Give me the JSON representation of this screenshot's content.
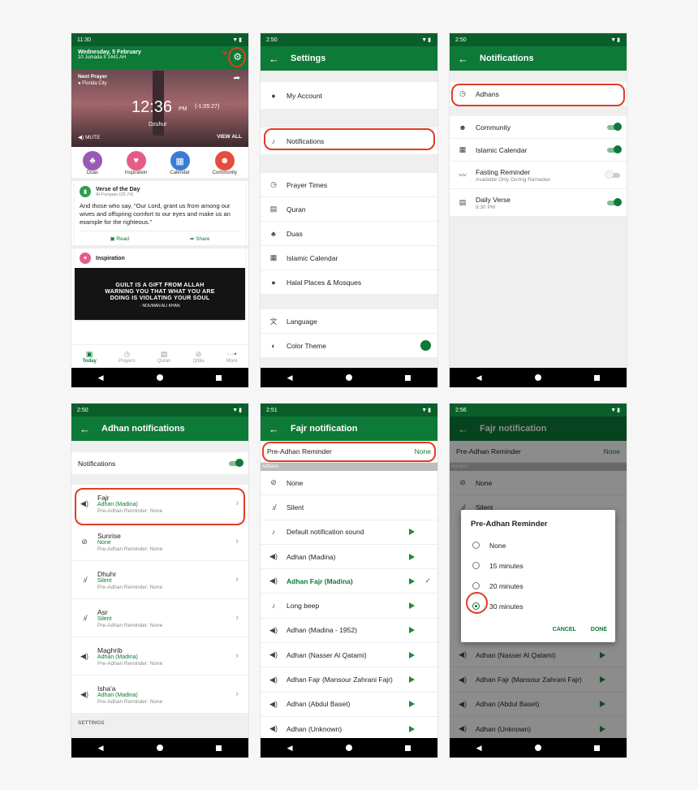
{
  "colors": {
    "brand": "#0d7a37",
    "statusbar": "#0a5e2a",
    "highlight": "#e33b24"
  },
  "p1": {
    "time": "11:30",
    "date": "Wednesday, 5 February",
    "hijri": "10 Jumada II 1441 AH",
    "next_label": "Next Prayer",
    "city": "Florida City",
    "clock": "12:36",
    "ampm": "PM",
    "countdown": "(-1:05:27)",
    "prayer": "Dzuhur",
    "mute": "MUTE",
    "view_all": "VIEW ALL",
    "quick": [
      {
        "label": "Duas",
        "color": "#9b59b6",
        "icon": "hands-icon"
      },
      {
        "label": "Inspiration",
        "color": "#e45d87",
        "icon": "heart-icon"
      },
      {
        "label": "Calendar",
        "color": "#3a7bd5",
        "icon": "calendar-icon"
      },
      {
        "label": "Community",
        "color": "#e74c3c",
        "icon": "people-icon"
      }
    ],
    "verse_title": "Verse of the Day",
    "verse_ref": "Al-Furqaan (25:74)",
    "verse_text": "And those who say, \"Our Lord, grant us from among our wives and offspring comfort to our eyes and make us an example for the righteous.\"",
    "read": "Read",
    "share": "Share",
    "insp_title": "Inspiration",
    "quote": "GUILT IS A GIFT FROM ALLAH WARNING YOU THAT WHAT YOU ARE DOING IS VIOLATING YOUR SOUL",
    "quote_author": "- NOUMAN ALI KHAN",
    "tabs": [
      "Today",
      "Prayers",
      "Quran",
      "Qibla",
      "More"
    ]
  },
  "p2": {
    "time": "2:50",
    "title": "Settings",
    "account": "My Account",
    "notifications": "Notifications",
    "items": [
      "Prayer Times",
      "Quran",
      "Duas",
      "Islamic Calendar",
      "Halal Places & Mosques"
    ],
    "language": "Language",
    "color_theme": "Color Theme"
  },
  "p3": {
    "time": "2:50",
    "title": "Notifications",
    "adhans": "Adhans",
    "items": [
      {
        "label": "Community",
        "sub": "",
        "on": true
      },
      {
        "label": "Islamic Calendar",
        "sub": "",
        "on": true
      },
      {
        "label": "Fasting Reminder",
        "sub": "Available Only During Ramadan",
        "on": false
      },
      {
        "label": "Daily Verse",
        "sub": "9:30 PM",
        "on": true
      }
    ]
  },
  "p4": {
    "time": "2:50",
    "title": "Adhan notifications",
    "notifications": "Notifications",
    "prayers": [
      {
        "name": "Fajr",
        "sound": "Adhan (Madina)",
        "reminder": "Pre-Adhan Reminder: None"
      },
      {
        "name": "Sunrise",
        "sound": "None",
        "reminder": "Pre-Adhan Reminder: None"
      },
      {
        "name": "Dhuhr",
        "sound": "Silent",
        "reminder": "Pre-Adhan Reminder: None"
      },
      {
        "name": "Asr",
        "sound": "Silent",
        "reminder": "Pre-Adhan Reminder: None"
      },
      {
        "name": "Maghrib",
        "sound": "Adhan (Madina)",
        "reminder": "Pre-Adhan Reminder: None"
      },
      {
        "name": "Isha'a",
        "sound": "Adhan (Madina)",
        "reminder": "Pre-Adhan Reminder: None"
      }
    ],
    "settings": "SETTINGS"
  },
  "p5": {
    "time": "2:51",
    "title": "Fajr notification",
    "pre_label": "Pre-Adhan Reminder",
    "pre_value": "None",
    "section": "Adhans",
    "sounds": [
      "None",
      "Silent",
      "Default notification sound",
      "Adhan (Madina)",
      "Adhan Fajr (Madina)",
      "Long beep",
      "Adhan (Madina - 1952)",
      "Adhan (Nasser Al Qatami)",
      "Adhan Fajr (Mansour Zahrani Fajr)",
      "Adhan (Abdul Baset)",
      "Adhan (Unknown)"
    ]
  },
  "p6": {
    "time": "2:56",
    "title": "Fajr notification",
    "pre_label": "Pre-Adhan Reminder",
    "pre_value": "None",
    "section": "Adhans",
    "bg_sounds": [
      "None",
      "Silent",
      "Adhan (Nasser Al Qatami)",
      "Adhan Fajr (Mansour Zahrani Fajr)",
      "Adhan (Abdul Baset)",
      "Adhan (Unknown)"
    ],
    "dialog_title": "Pre-Adhan Reminder",
    "options": [
      "None",
      "15 minutes",
      "20 minutes",
      "30 minutes"
    ],
    "cancel": "CANCEL",
    "done": "DONE"
  }
}
